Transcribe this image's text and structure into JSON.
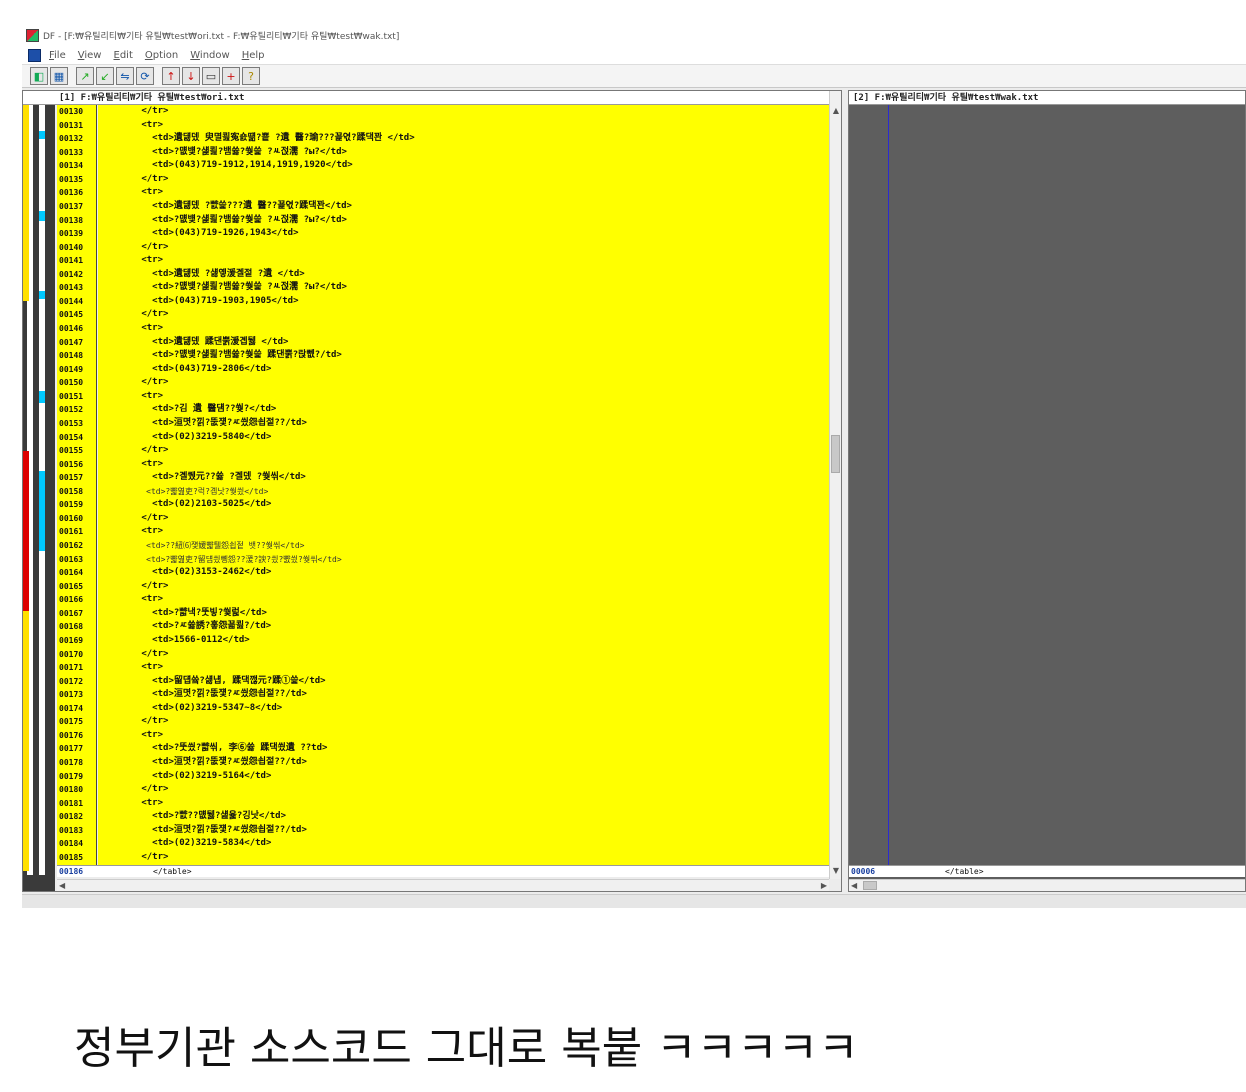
{
  "window": {
    "title": "DF - [F:₩유틸리티₩기타 유틸₩test₩ori.txt - F:₩유틸리티₩기타 유틸₩test₩wak.txt]"
  },
  "menu": [
    "File",
    "View",
    "Edit",
    "Option",
    "Window",
    "Help"
  ],
  "toolbar": {
    "icons": [
      "compare-icon",
      "sync-icon",
      "prev-diff-icon",
      "next-diff-icon",
      "merge-icon",
      "refresh-icon",
      "first-diff-icon",
      "last-diff-icon",
      "window-icon",
      "add-icon",
      "help-icon"
    ],
    "glyphs": [
      "◧",
      "▦",
      "↗",
      "↙",
      "⇋",
      "⟳",
      "↑",
      "↓",
      "▭",
      "+",
      "?"
    ]
  },
  "left_pane": {
    "header": "[1] F:₩유틸리티₩기타 유틸₩test₩ori.txt",
    "lines": [
      {
        "n": "00130",
        "t": "        </tr>"
      },
      {
        "n": "00131",
        "t": "        <tr>"
      },
      {
        "n": "00132",
        "t": "          <td>遺덇뎄 臾멸쾶寃숈떎?뿉 ?遺 醫?瑜???꾩엯?蹂댁꽌 </td>"
      },
      {
        "n": "00133",
        "t": "          <td>?먮뱾?섍쾶?뱀쓣?쒖쓽 ?ㅻ젅濡 ?ы?</td>"
      },
      {
        "n": "00134",
        "t": "          <td>(043)719-1912,1914,1919,1920</td>"
      },
      {
        "n": "00135",
        "t": "        </tr>"
      },
      {
        "n": "00136",
        "t": "        <tr>"
      },
      {
        "n": "00137",
        "t": "          <td>遺덇뎄 ?뺤쓽???遺 醫??꾩엯?蹂댁꽌</td>"
      },
      {
        "n": "00138",
        "t": "          <td>?먮뱾?섍쾶?뱀쓣?쒖쓽 ?ㅻ젅濡 ?ы?</td>"
      },
      {
        "n": "00139",
        "t": "          <td>(043)719-1926,1943</td>"
      },
      {
        "n": "00140",
        "t": "        </tr>"
      },
      {
        "n": "00141",
        "t": "        <tr>"
      },
      {
        "n": "00142",
        "t": "          <td>遺덇뎄 ?섏옣湲곌젙 ?遺 </td>"
      },
      {
        "n": "00143",
        "t": "          <td>?먮뱾?섍쾶?뱀쓣?쒖쓽 ?ㅻ젅濡 ?ы?</td>"
      },
      {
        "n": "00144",
        "t": "          <td>(043)719-1903,1905</td>"
      },
      {
        "n": "00145",
        "t": "        </tr>"
      },
      {
        "n": "00146",
        "t": "        <tr>"
      },
      {
        "n": "00147",
        "t": "          <td>遺덇뎄 蹂댄뿕湲곕뒗 </td>"
      },
      {
        "n": "00148",
        "t": "          <td>?먮뱾?섍쾶?뱀쓣?쒖쓽 蹂댄뿕?랁뻾?/td>"
      },
      {
        "n": "00149",
        "t": "          <td>(043)719-2806</td>"
      },
      {
        "n": "00150",
        "t": "        </tr>"
      },
      {
        "n": "00151",
        "t": "        <tr>"
      },
      {
        "n": "00152",
        "t": "          <td>?김 遺 醫덈??쒖?</td>"
      },
      {
        "n": "00153",
        "t": "          <td>洹몃?낅?뚮쟻?ㅼ씠怨쇱젙??/td>"
      },
      {
        "n": "00154",
        "t": "          <td>(02)3219-5840</td>"
      },
      {
        "n": "00155",
        "t": "        </tr>"
      },
      {
        "n": "00156",
        "t": "        <tr>"
      },
      {
        "n": "00157",
        "t": "          <td>?곌퀬元??쓣 ?곌뎄 ?쒖씪</td>"
      },
      {
        "n": "00158",
        "t": "          <td>?뺣엺吏?럭?곕낫?쒖씠</td>",
        "dim": true
      },
      {
        "n": "00159",
        "t": "          <td>(02)2103-5025</td>"
      },
      {
        "n": "00160",
        "t": "        </tr>"
      },
      {
        "n": "00161",
        "t": "        <tr>"
      },
      {
        "n": "00162",
        "t": "          <td>??紐⑹쟻媛뺣퉬怨쇱젙 뱃??쒖씪</td>",
        "dim": true
      },
      {
        "n": "00163",
        "t": "          <td>?뺣엺吏?留덉씠뼹怨??湲?諛?씠?뺤씠?쒖씪</td>",
        "dim": true
      },
      {
        "n": "00164",
        "t": "          <td>(02)3153-2462</td>"
      },
      {
        "n": "00165",
        "t": "        </tr>"
      },
      {
        "n": "00166",
        "t": "        <tr>"
      },
      {
        "n": "00167",
        "t": "          <td>?뺣낵?뚯빟?쒗럹</td>"
      },
      {
        "n": "00168",
        "t": "          <td>?ㅼ쓣誘?흫怨꾧쾶?/td>"
      },
      {
        "n": "00169",
        "t": "          <td>1566-0112</td>"
      },
      {
        "n": "00170",
        "t": "        </tr>"
      },
      {
        "n": "00171",
        "t": "        <tr>"
      },
      {
        "n": "00172",
        "t": "          <td>留덉쓬?섏냽, 蹂댁깮元?蹂①쓽</td>"
      },
      {
        "n": "00173",
        "t": "          <td>洹몃?낅?뚮쟻?ㅼ씠怨쇱젙??/td>"
      },
      {
        "n": "00174",
        "t": "          <td>(02)3219-5347~8</td>"
      },
      {
        "n": "00175",
        "t": "        </tr>"
      },
      {
        "n": "00176",
        "t": "        <tr>"
      },
      {
        "n": "00177",
        "t": "          <td>?뚯씠?뺣씪, 李⑥쓣 蹂댁쑀遺 ??td>"
      },
      {
        "n": "00178",
        "t": "          <td>洹몃?낅?뚮쟻?ㅼ씠怨쇱젙??/td>"
      },
      {
        "n": "00179",
        "t": "          <td>(02)3219-5164</td>"
      },
      {
        "n": "00180",
        "t": "        </tr>"
      },
      {
        "n": "00181",
        "t": "        <tr>"
      },
      {
        "n": "00182",
        "t": "          <td>?뺤??먮뒗?섎윭?깅낫</td>"
      },
      {
        "n": "00183",
        "t": "          <td>洹몃?낅?뚮쟻?ㅼ씠怨쇱젙??/td>"
      },
      {
        "n": "00184",
        "t": "          <td>(02)3219-5834</td>"
      },
      {
        "n": "00185",
        "t": "        </tr>"
      }
    ],
    "last_line": {
      "n": "00186",
      "t": "      </table>"
    }
  },
  "right_pane": {
    "header": "[2] F:₩유틸리티₩기타 유틸₩test₩wak.txt",
    "last_line": {
      "n": "00006",
      "t": "      </table>"
    }
  },
  "caption": "정부기관 소스코드 그대로 복붙 ㅋㅋㅋㅋㅋ"
}
